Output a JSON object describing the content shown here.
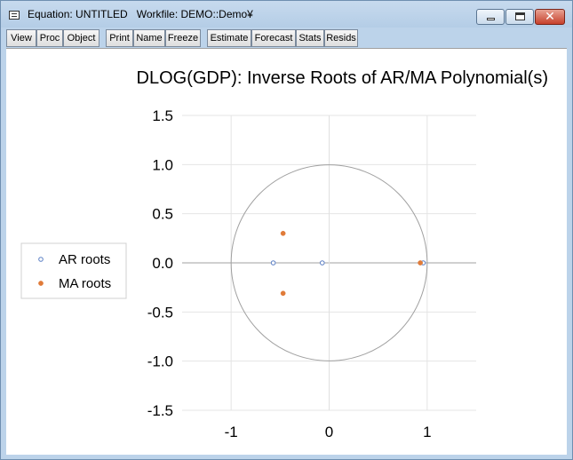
{
  "window": {
    "title": "Equation: UNTITLED   Workfile: DEMO::Demo¥",
    "controls": {
      "minimize_icon": "minimize-icon",
      "maximize_icon": "maximize-icon",
      "close_icon": "close-icon",
      "close_glyph": "✕"
    }
  },
  "toolbar": {
    "buttons": [
      "View",
      "Proc",
      "Object",
      "Print",
      "Name",
      "Freeze",
      "Estimate",
      "Forecast",
      "Stats",
      "Resids"
    ]
  },
  "chart_data": {
    "type": "scatter",
    "title": "DLOG(GDP): Inverse Roots of AR/MA Polynomial(s)",
    "xlim": [
      -1.5,
      1.5
    ],
    "ylim": [
      -1.5,
      1.5
    ],
    "x_ticks": [
      "-1",
      "0",
      "1"
    ],
    "x_tick_values": [
      -1,
      0,
      1
    ],
    "y_ticks": [
      "1.5",
      "1.0",
      "0.5",
      "0.0",
      "-0.5",
      "-1.0",
      "-1.5"
    ],
    "y_tick_values": [
      1.5,
      1.0,
      0.5,
      0.0,
      -0.5,
      -1.0,
      -1.5
    ],
    "grid": true,
    "unit_circle": true,
    "legend_position": "left",
    "series": [
      {
        "name": "AR roots",
        "marker": "hollow-circle",
        "color": "#5b7fc4",
        "points": [
          {
            "x": -0.57,
            "y": 0.0
          },
          {
            "x": -0.07,
            "y": 0.0
          },
          {
            "x": 0.96,
            "y": 0.0
          }
        ]
      },
      {
        "name": "MA roots",
        "marker": "filled-circle",
        "color": "#e07b39",
        "points": [
          {
            "x": -0.47,
            "y": 0.3
          },
          {
            "x": -0.47,
            "y": -0.31
          },
          {
            "x": 0.93,
            "y": 0.0
          }
        ]
      }
    ]
  }
}
